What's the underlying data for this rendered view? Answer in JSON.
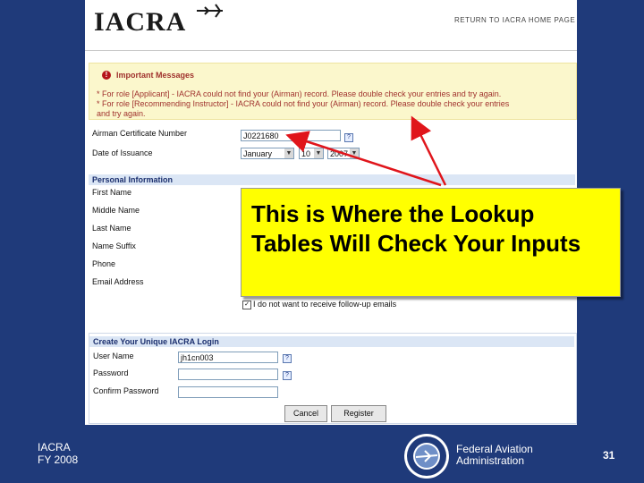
{
  "header": {
    "logo_text": "IACRA",
    "return_link": "RETURN TO IACRA HOME PAGE"
  },
  "messages": {
    "title": "Important Messages",
    "lines": [
      "* For role [Applicant] - IACRA could not find your (Airman) record. Please double check your entries and try again.",
      "* For role [Recommending Instructor] - IACRA could not find your (Airman) record. Please double check your entries",
      "and try again."
    ]
  },
  "lookup": {
    "cert_label": "Airman Certificate Number",
    "cert_value": "J0221680",
    "date_label": "Date of Issuance",
    "month": "January",
    "day": "10",
    "year": "2007"
  },
  "personal": {
    "title": "Personal Information",
    "labels": [
      "First Name",
      "Middle Name",
      "Last Name",
      "Name Suffix",
      "Phone",
      "Email Address"
    ],
    "followup_label": "I do not want to receive follow-up emails"
  },
  "login": {
    "title": "Create Your Unique IACRA Login",
    "user_label": "User Name",
    "user_value": "jh1cn003",
    "password_label": "Password",
    "confirm_label": "Confirm Password",
    "cancel_label": "Cancel",
    "register_label": "Register"
  },
  "callout": {
    "text": "This is Where the Lookup Tables Will Check Your Inputs"
  },
  "footer": {
    "left_line1": "IACRA",
    "left_line2": "FY 2008",
    "faa_line1": "Federal Aviation",
    "faa_line2": "Administration",
    "page_number": "31"
  },
  "colors": {
    "slide_background": "#1f3a7a",
    "callout": "#ffff00",
    "arrow": "#e0151b",
    "message_text": "#a0322e",
    "message_background": "#fbf7cc"
  },
  "icons": [
    "plane-icon",
    "alert-icon",
    "help-icon",
    "faa-seal-icon"
  ]
}
